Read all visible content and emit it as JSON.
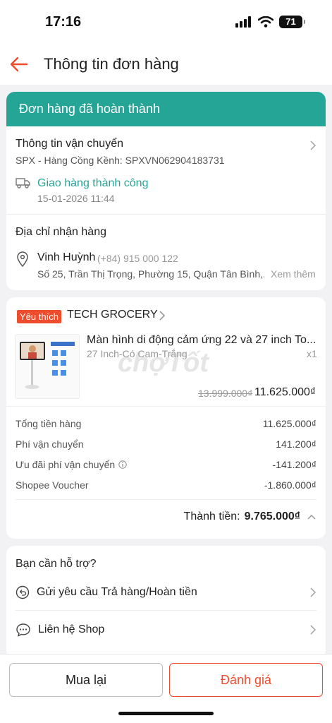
{
  "status_bar": {
    "time": "17:16",
    "battery": "71"
  },
  "header": {
    "title": "Thông tin đơn hàng"
  },
  "order": {
    "status_banner": "Đơn hàng đã hoàn thành",
    "shipping": {
      "title": "Thông tin vận chuyển",
      "carrier_line": "SPX - Hàng Cồng Kềnh: SPXVN062904183731",
      "delivery_status": "Giao hàng thành công",
      "delivery_time": "15-01-2026 11:44"
    },
    "address": {
      "title": "Địa chỉ nhận hàng",
      "name": "Vinh Huỳnh",
      "phone": "(+84) 915 000 122",
      "address_line": "Số 25, Trần Thị Trọng, Phường 15, Quận Tân Bình,...",
      "see_more": "Xem thêm"
    }
  },
  "shop": {
    "tag": "Yêu thích",
    "name": "TECH GROCERY",
    "product": {
      "title": "Màn hình di động cảm ứng 22 và 27 inch To...",
      "variant": "27 Inch-Có Cam-Trắng",
      "qty": "x1",
      "original_price": "13.999.000₫",
      "price": "11.625.000₫",
      "watermark": "chợTốt"
    },
    "summary": [
      {
        "label": "Tổng tiền hàng",
        "value": "11.625.000₫"
      },
      {
        "label": "Phí vận chuyển",
        "value": "141.200₫"
      },
      {
        "label": "Ưu đãi phí vận chuyển",
        "value": "-141.200₫"
      },
      {
        "label": "Shopee Voucher",
        "value": "-1.860.000₫"
      }
    ],
    "total_label": "Thành tiền:",
    "total_value": "9.765.000₫"
  },
  "support": {
    "title": "Bạn cần hỗ trợ?",
    "items": [
      {
        "label": "Gửi yêu cầu Trả hàng/Hoàn tiền",
        "icon": "return-icon"
      },
      {
        "label": "Liên hệ Shop",
        "icon": "chat-icon"
      }
    ]
  },
  "actions": {
    "buy_again": "Mua lại",
    "rate": "Đánh giá"
  },
  "colors": {
    "accent": "#ee4d2d",
    "success": "#25a596"
  }
}
